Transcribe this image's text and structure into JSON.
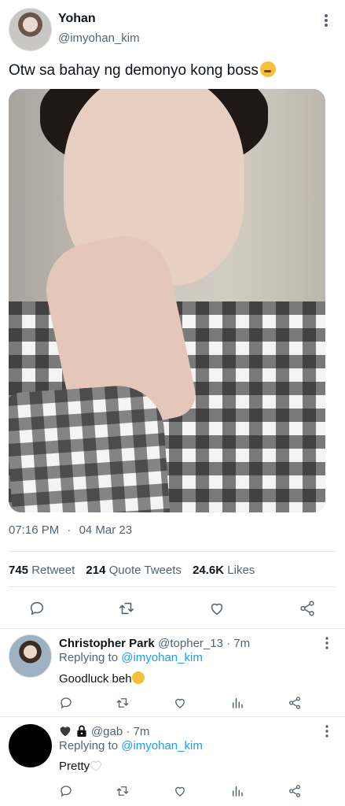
{
  "tweet": {
    "author_name": "Yohan",
    "author_handle": "@imyohan_kim",
    "text": "Otw sa bahay ng demonyo kong boss",
    "time": "07:16 PM",
    "dot": "·",
    "date": "04 Mar 23",
    "stats": {
      "retweets_count": "745",
      "retweets_label": "Retweet",
      "quotes_count": "214",
      "quotes_label": "Quote Tweets",
      "likes_count": "24.6K",
      "likes_label": "Likes"
    }
  },
  "replies": [
    {
      "name": "Christopher Park",
      "meta": "@topher_13 · 7m",
      "replying_prefix": "Replying to",
      "replying_to": "@imyohan_kim",
      "text": "Goodluck beh"
    },
    {
      "meta": "@gab · 7m",
      "replying_prefix": "Replying to",
      "replying_to": "@imyohan_kim",
      "text": "Pretty"
    }
  ],
  "colors": {
    "link": "#1d9bf0",
    "muted": "#536471",
    "text": "#0f1419"
  },
  "icons": [
    "more-vertical-icon",
    "reply-icon",
    "retweet-icon",
    "like-icon",
    "share-icon",
    "analytics-icon",
    "heart-icon",
    "lock-icon"
  ]
}
